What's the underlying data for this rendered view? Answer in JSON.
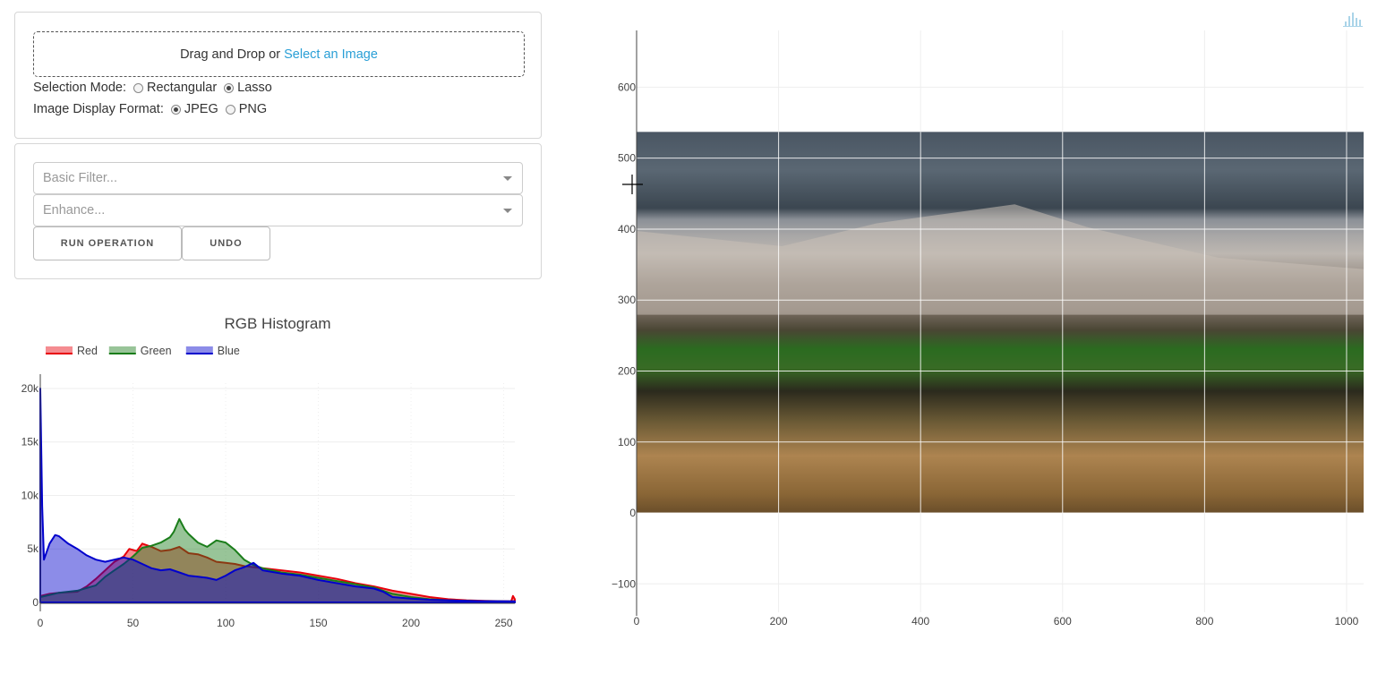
{
  "upload": {
    "drop_text": "Drag and Drop or",
    "link_text": "Select an Image",
    "selection_mode": {
      "label": "Selection Mode:",
      "options": [
        "Rectangular",
        "Lasso"
      ],
      "selected": "Lasso"
    },
    "display_format": {
      "label": "Image Display Format:",
      "options": [
        "JPEG",
        "PNG"
      ],
      "selected": "JPEG"
    }
  },
  "operations": {
    "basic_filter_placeholder": "Basic Filter...",
    "enhance_placeholder": "Enhance...",
    "run_label": "RUN OPERATION",
    "undo_label": "UNDO"
  },
  "histogram": {
    "chart_data": {
      "type": "area",
      "title": "RGB Histogram",
      "xlim": [
        0,
        256
      ],
      "ylim": [
        0,
        20500
      ],
      "x_ticks": [
        0,
        50,
        100,
        150,
        200,
        250
      ],
      "y_ticks": [
        0,
        5000,
        10000,
        15000,
        20000
      ],
      "y_tick_labels": [
        "0",
        "5k",
        "10k",
        "15k",
        "20k"
      ],
      "legend_position": "top-left",
      "series": [
        {
          "name": "Red",
          "color": "#e8000b",
          "points": [
            [
              0,
              600
            ],
            [
              5,
              800
            ],
            [
              10,
              900
            ],
            [
              20,
              1000
            ],
            [
              25,
              1500
            ],
            [
              30,
              2200
            ],
            [
              35,
              3000
            ],
            [
              40,
              3800
            ],
            [
              45,
              4300
            ],
            [
              48,
              5000
            ],
            [
              52,
              4800
            ],
            [
              55,
              5500
            ],
            [
              60,
              5200
            ],
            [
              65,
              4800
            ],
            [
              70,
              4900
            ],
            [
              75,
              5200
            ],
            [
              80,
              4600
            ],
            [
              85,
              4500
            ],
            [
              90,
              4200
            ],
            [
              95,
              3800
            ],
            [
              100,
              3700
            ],
            [
              105,
              3600
            ],
            [
              110,
              3400
            ],
            [
              120,
              3200
            ],
            [
              130,
              3000
            ],
            [
              140,
              2800
            ],
            [
              150,
              2500
            ],
            [
              160,
              2200
            ],
            [
              170,
              1800
            ],
            [
              180,
              1500
            ],
            [
              190,
              1100
            ],
            [
              200,
              800
            ],
            [
              210,
              500
            ],
            [
              220,
              300
            ],
            [
              230,
              200
            ],
            [
              240,
              150
            ],
            [
              250,
              120
            ],
            [
              254,
              100
            ],
            [
              255,
              600
            ],
            [
              256,
              300
            ]
          ]
        },
        {
          "name": "Green",
          "color": "#1a7d1a",
          "points": [
            [
              0,
              500
            ],
            [
              5,
              700
            ],
            [
              10,
              900
            ],
            [
              20,
              1100
            ],
            [
              30,
              1600
            ],
            [
              35,
              2400
            ],
            [
              40,
              3000
            ],
            [
              45,
              3600
            ],
            [
              50,
              4300
            ],
            [
              55,
              5100
            ],
            [
              60,
              5300
            ],
            [
              65,
              5600
            ],
            [
              70,
              6100
            ],
            [
              72,
              6600
            ],
            [
              75,
              7800
            ],
            [
              78,
              6800
            ],
            [
              80,
              6400
            ],
            [
              85,
              5600
            ],
            [
              90,
              5200
            ],
            [
              95,
              5800
            ],
            [
              100,
              5600
            ],
            [
              105,
              4900
            ],
            [
              110,
              4000
            ],
            [
              115,
              3500
            ],
            [
              120,
              3200
            ],
            [
              130,
              2800
            ],
            [
              140,
              2600
            ],
            [
              150,
              2300
            ],
            [
              160,
              2000
            ],
            [
              170,
              1700
            ],
            [
              180,
              1400
            ],
            [
              185,
              1100
            ],
            [
              190,
              800
            ],
            [
              200,
              500
            ],
            [
              210,
              300
            ],
            [
              220,
              200
            ],
            [
              230,
              150
            ],
            [
              240,
              120
            ],
            [
              256,
              80
            ]
          ]
        },
        {
          "name": "Blue",
          "color": "#0000cc",
          "points": [
            [
              0,
              20000
            ],
            [
              1,
              9000
            ],
            [
              2,
              4000
            ],
            [
              3,
              4500
            ],
            [
              5,
              5500
            ],
            [
              8,
              6300
            ],
            [
              10,
              6200
            ],
            [
              15,
              5500
            ],
            [
              20,
              5000
            ],
            [
              25,
              4400
            ],
            [
              30,
              4000
            ],
            [
              35,
              3800
            ],
            [
              40,
              4000
            ],
            [
              45,
              4200
            ],
            [
              50,
              4000
            ],
            [
              55,
              3600
            ],
            [
              60,
              3200
            ],
            [
              65,
              3000
            ],
            [
              70,
              3100
            ],
            [
              75,
              2800
            ],
            [
              80,
              2500
            ],
            [
              85,
              2400
            ],
            [
              90,
              2300
            ],
            [
              95,
              2100
            ],
            [
              100,
              2500
            ],
            [
              105,
              3000
            ],
            [
              110,
              3300
            ],
            [
              115,
              3700
            ],
            [
              120,
              3000
            ],
            [
              130,
              2700
            ],
            [
              140,
              2500
            ],
            [
              150,
              2100
            ],
            [
              160,
              1800
            ],
            [
              170,
              1500
            ],
            [
              180,
              1300
            ],
            [
              185,
              1000
            ],
            [
              190,
              500
            ],
            [
              200,
              350
            ],
            [
              210,
              250
            ],
            [
              220,
              200
            ],
            [
              230,
              150
            ],
            [
              240,
              120
            ],
            [
              256,
              100
            ]
          ]
        }
      ]
    }
  },
  "image_graph": {
    "chart_data": {
      "type": "image",
      "xlim": [
        0,
        1024
      ],
      "ylim": [
        -140,
        680
      ],
      "x_ticks": [
        0,
        200,
        400,
        600,
        800,
        1000
      ],
      "y_ticks": [
        -100,
        0,
        100,
        200,
        300,
        400,
        500,
        600
      ],
      "y_tick_labels": [
        "−100",
        "0",
        "100",
        "200",
        "300",
        "400",
        "500",
        "600"
      ],
      "image_extent": {
        "x": [
          0,
          1024
        ],
        "y": [
          0,
          537
        ]
      },
      "grid": true
    }
  }
}
